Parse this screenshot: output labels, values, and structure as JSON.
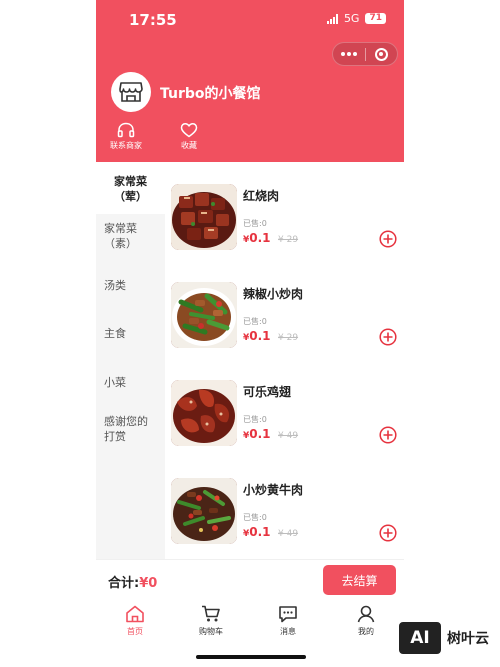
{
  "status_bar": {
    "time": "17:55",
    "network": "5G",
    "battery": "71"
  },
  "shop": {
    "name": "Turbo的小餐馆"
  },
  "header_actions": [
    {
      "label": "联系商家",
      "icon": "headset-icon"
    },
    {
      "label": "收藏",
      "icon": "heart-icon"
    }
  ],
  "categories": [
    {
      "label": "家常菜（荤）",
      "active": true
    },
    {
      "label": "家常菜（素）",
      "active": false
    },
    {
      "label": "汤类",
      "active": false
    },
    {
      "label": "主食",
      "active": false
    },
    {
      "label": "小菜",
      "active": false
    },
    {
      "label": "感谢您的打赏",
      "active": false
    }
  ],
  "dishes": [
    {
      "name": "红烧肉",
      "sold": "已售:0",
      "currency": "¥",
      "price": "0.1",
      "original_price": "¥ 29"
    },
    {
      "name": "辣椒小炒肉",
      "sold": "已售:0",
      "currency": "¥",
      "price": "0.1",
      "original_price": "¥ 29"
    },
    {
      "name": "可乐鸡翅",
      "sold": "已售:0",
      "currency": "¥",
      "price": "0.1",
      "original_price": "¥ 49"
    },
    {
      "name": "小炒黄牛肉",
      "sold": "已售:0",
      "currency": "¥",
      "price": "0.1",
      "original_price": "¥ 49"
    }
  ],
  "checkout": {
    "total_label": "合计:",
    "total_amount": "¥0",
    "button_label": "去结算"
  },
  "tabbar": [
    {
      "label": "首页",
      "icon": "home-icon",
      "active": true
    },
    {
      "label": "购物车",
      "icon": "cart-icon",
      "active": false
    },
    {
      "label": "消息",
      "icon": "message-icon",
      "active": false
    },
    {
      "label": "我的",
      "icon": "user-icon",
      "active": false
    }
  ],
  "watermark": {
    "logo": "AI",
    "text": "树叶云"
  },
  "colors": {
    "brand": "#f1505f",
    "price": "#e6333f"
  }
}
